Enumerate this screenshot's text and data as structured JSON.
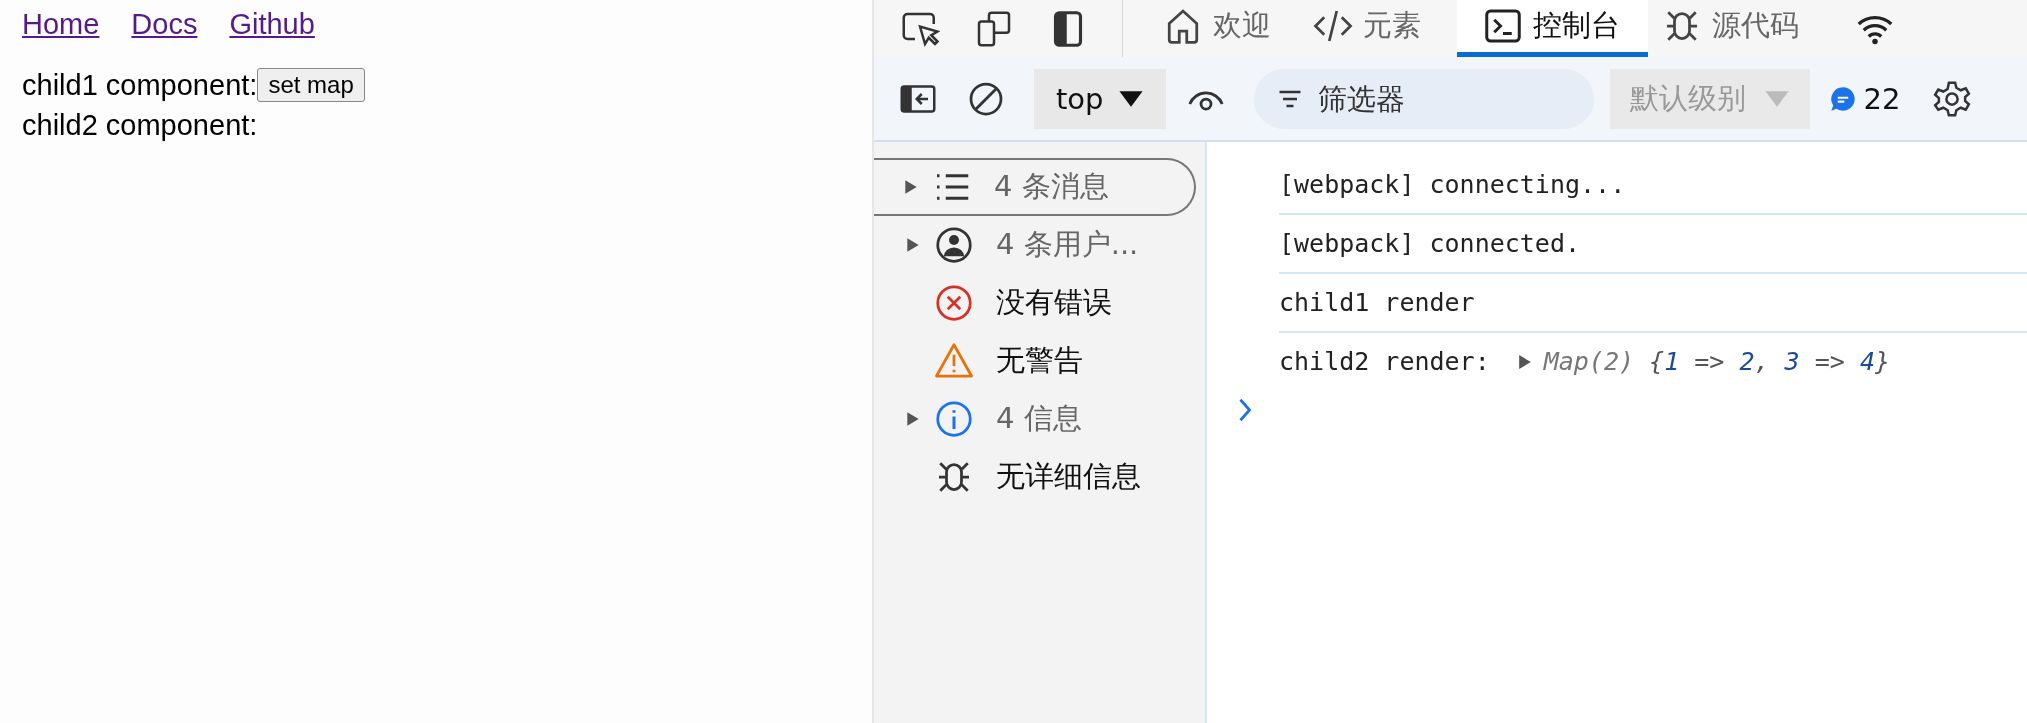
{
  "page": {
    "links": [
      "Home",
      "Docs",
      "Github"
    ],
    "lines": [
      {
        "label": "child1 component:",
        "button": "set map"
      },
      {
        "label": "child2 component:"
      }
    ]
  },
  "devtools": {
    "tabs": [
      {
        "label": "欢迎",
        "selected": false
      },
      {
        "label": "元素",
        "selected": false
      },
      {
        "label": "控制台",
        "selected": true
      },
      {
        "label": "源代码",
        "selected": false
      }
    ],
    "toolbar": {
      "context": "top",
      "filter_placeholder": "筛选器",
      "level": "默认级别",
      "level_disabled": true,
      "message_count": "22"
    },
    "sidebar": [
      {
        "label": "4 条消息",
        "kind": "messages",
        "expandable": true,
        "selected": true
      },
      {
        "label": "4 条用户...",
        "kind": "user",
        "expandable": true,
        "selected": false
      },
      {
        "label": "没有错误",
        "kind": "error",
        "expandable": false,
        "selected": false
      },
      {
        "label": "无警告",
        "kind": "warning",
        "expandable": false,
        "selected": false
      },
      {
        "label": "4 信息",
        "kind": "info",
        "expandable": true,
        "selected": false
      },
      {
        "label": "无详细信息",
        "kind": "verbose",
        "expandable": false,
        "selected": false
      }
    ],
    "console": [
      {
        "text": "[webpack] connecting..."
      },
      {
        "text": "[webpack] connected."
      },
      {
        "text": "child1 render"
      },
      {
        "text": "child2 render:",
        "object": [
          {
            "text": "Map(2) ",
            "kind": "type"
          },
          {
            "text": "{",
            "kind": "punct"
          },
          {
            "text": "1",
            "kind": "number"
          },
          {
            "text": " => ",
            "kind": "punct"
          },
          {
            "text": "2",
            "kind": "number"
          },
          {
            "text": ", ",
            "kind": "punct"
          },
          {
            "text": "3",
            "kind": "number"
          },
          {
            "text": " => ",
            "kind": "punct"
          },
          {
            "text": "4",
            "kind": "number"
          },
          {
            "text": "}",
            "kind": "punct"
          }
        ]
      }
    ]
  }
}
